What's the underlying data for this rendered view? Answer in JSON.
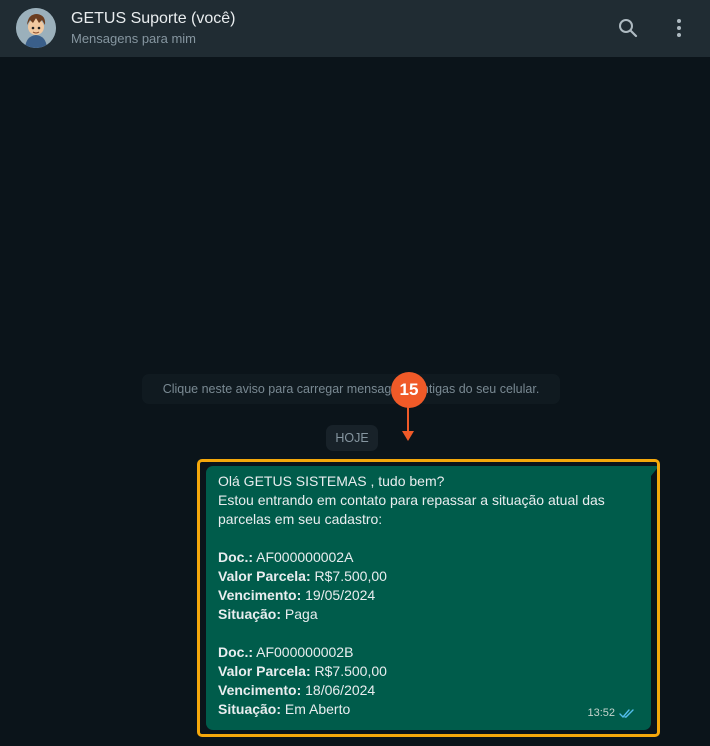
{
  "header": {
    "title": "GETUS Suporte (você)",
    "subtitle": "Mensagens para mim",
    "avatar_icon": "cartoon-avatar-icon",
    "search_icon": "search-icon",
    "menu_icon": "more-vertical-icon"
  },
  "chat": {
    "load_notice": "Clique neste aviso para carregar mensagens antigas do seu celular.",
    "date_separator": "HOJE"
  },
  "annotation": {
    "step_number": "15",
    "badge_color": "#f05a28",
    "highlight_color": "#f5a80b"
  },
  "message": {
    "greeting": "Olá GETUS SISTEMAS , tudo bem?",
    "intro_line1": "Estou entrando em contato para repassar a situação atual das",
    "intro_line2": "parcelas em seu cadastro:",
    "items": [
      {
        "doc_label": "Doc.:",
        "doc_value": " AF000000002A",
        "valor_label": "Valor Parcela:",
        "valor_value": " R$7.500,00",
        "venc_label": "Vencimento:",
        "venc_value": " 19/05/2024",
        "sit_label": "Situação:",
        "sit_value": " Paga"
      },
      {
        "doc_label": "Doc.:",
        "doc_value": " AF000000002B",
        "valor_label": "Valor Parcela:",
        "valor_value": " R$7.500,00",
        "venc_label": "Vencimento:",
        "venc_value": " 18/06/2024",
        "sit_label": "Situação:",
        "sit_value": " Em Aberto"
      }
    ],
    "time": "13:52",
    "status_icon": "double-check-icon"
  },
  "colors": {
    "outgoing_bubble": "#005c4b",
    "header_bg": "#202c33",
    "chat_bg": "#0b141a",
    "read_tick": "#53bdeb"
  }
}
